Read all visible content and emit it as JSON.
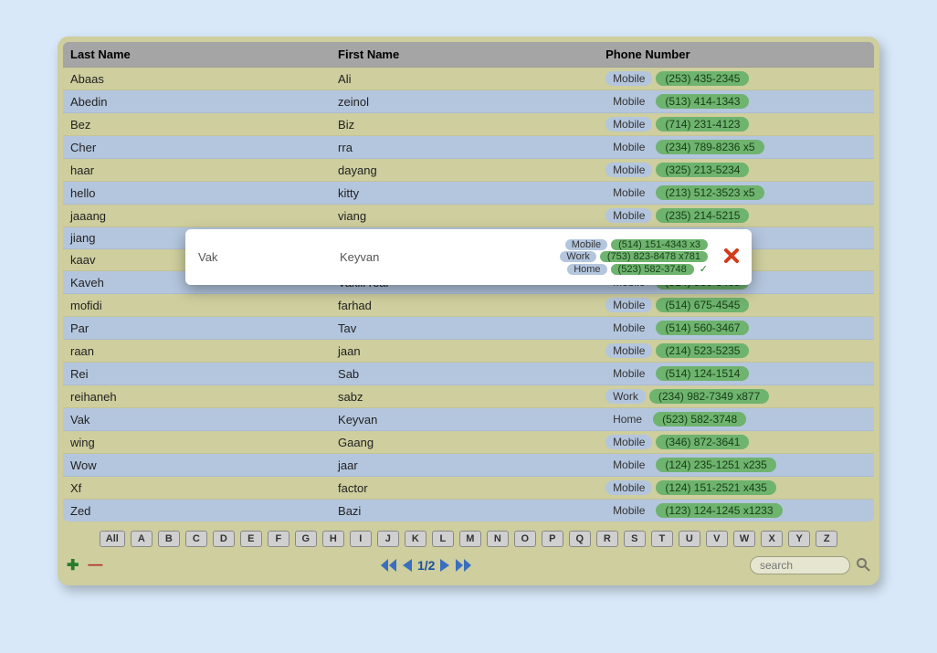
{
  "columns": {
    "last": "Last Name",
    "first": "First Name",
    "phone": "Phone Number"
  },
  "rows": [
    {
      "last": "Abaas",
      "first": "Ali",
      "ptype": "Mobile",
      "pnum": "(253) 435-2345"
    },
    {
      "last": "Abedin",
      "first": "zeinol",
      "ptype": "Mobile",
      "pnum": "(513) 414-1343"
    },
    {
      "last": "Bez",
      "first": "Biz",
      "ptype": "Mobile",
      "pnum": "(714) 231-4123"
    },
    {
      "last": "Cher",
      "first": "rra",
      "ptype": "Mobile",
      "pnum": "(234) 789-8236 x5"
    },
    {
      "last": "haar",
      "first": "dayang",
      "ptype": "Mobile",
      "pnum": "(325) 213-5234"
    },
    {
      "last": "hello",
      "first": "kitty",
      "ptype": "Mobile",
      "pnum": "(213) 512-3523 x5"
    },
    {
      "last": "jaaang",
      "first": "viang",
      "ptype": "Mobile",
      "pnum": "(235) 214-5215"
    },
    {
      "last": "jiang",
      "first": "",
      "ptype": "",
      "pnum": ""
    },
    {
      "last": "kaav",
      "first": "",
      "ptype": "",
      "pnum": ""
    },
    {
      "last": "Kaveh",
      "first": "Vakili real",
      "ptype": "Mobile",
      "pnum": "(514) 560-3468"
    },
    {
      "last": "mofidi",
      "first": "farhad",
      "ptype": "Mobile",
      "pnum": "(514) 675-4545"
    },
    {
      "last": "Par",
      "first": "Tav",
      "ptype": "Mobile",
      "pnum": "(514) 560-3467"
    },
    {
      "last": "raan",
      "first": "jaan",
      "ptype": "Mobile",
      "pnum": "(214) 523-5235"
    },
    {
      "last": "Rei",
      "first": "Sab",
      "ptype": "Mobile",
      "pnum": "(514) 124-1514"
    },
    {
      "last": "reihaneh",
      "first": "sabz",
      "ptype": "Work",
      "pnum": "(234) 982-7349 x877"
    },
    {
      "last": "Vak",
      "first": "Keyvan",
      "ptype": "Home",
      "pnum": "(523) 582-3748"
    },
    {
      "last": "wing",
      "first": "Gaang",
      "ptype": "Mobile",
      "pnum": "(346) 872-3641"
    },
    {
      "last": "Wow",
      "first": "jaar",
      "ptype": "Mobile",
      "pnum": "(124) 235-1251 x235"
    },
    {
      "last": "Xf",
      "first": "factor",
      "ptype": "Mobile",
      "pnum": "(124) 151-2521 x435"
    },
    {
      "last": "Zed",
      "first": "Bazi",
      "ptype": "Mobile",
      "pnum": "(123) 124-1245 x1233"
    }
  ],
  "popup": {
    "last": "Vak",
    "first": "Keyvan",
    "phones": [
      {
        "type": "Mobile",
        "num": "(514) 151-4343 x3",
        "preferred": false
      },
      {
        "type": "Work",
        "num": "(753) 823-8478 x781",
        "preferred": false
      },
      {
        "type": "Home",
        "num": "(523) 582-3748",
        "preferred": true
      }
    ]
  },
  "alpha": {
    "all": "All",
    "letters": [
      "A",
      "B",
      "C",
      "D",
      "E",
      "F",
      "G",
      "H",
      "I",
      "J",
      "K",
      "L",
      "M",
      "N",
      "O",
      "P",
      "Q",
      "R",
      "S",
      "T",
      "U",
      "V",
      "W",
      "X",
      "Y",
      "Z"
    ]
  },
  "pager": {
    "label": "1/2"
  },
  "search": {
    "placeholder": "search"
  }
}
